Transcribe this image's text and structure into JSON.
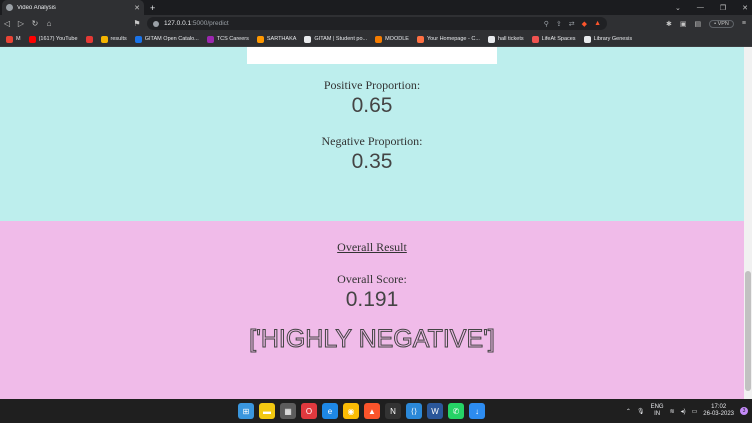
{
  "browser": {
    "tab_title": "Video Analysis",
    "tab_close": "✕",
    "new_tab": "+",
    "url_host": "127.0.0.1",
    "url_path": ":5000/predict",
    "vpn_label": "• VPN",
    "window_controls": [
      "⌄",
      "—",
      "❐",
      "✕"
    ],
    "nav_icons": [
      "◁",
      "▷",
      "↻",
      "⌂"
    ],
    "bookmark_icon": "⚑"
  },
  "bookmarks": [
    {
      "label": "M",
      "color": "#ea4335"
    },
    {
      "label": "(1617) YouTube",
      "color": "#ff0000"
    },
    {
      "label": "",
      "color": "#e53935"
    },
    {
      "label": "results",
      "color": "#f4b400"
    },
    {
      "label": "GITAM Open Catalo...",
      "color": "#1a73e8"
    },
    {
      "label": "TCS Careers",
      "color": "#9c27b0"
    },
    {
      "label": "SARTHAKA",
      "color": "#ff9800"
    },
    {
      "label": "GITAM | Student po...",
      "color": "#e8eaed"
    },
    {
      "label": "MOODLE",
      "color": "#f57c00"
    },
    {
      "label": "Your Homepage - C...",
      "color": "#ff7043"
    },
    {
      "label": "hall tickets",
      "color": "#e8eaed"
    },
    {
      "label": "LifeAt Spaces",
      "color": "#ef5350"
    },
    {
      "label": "Library Genesis",
      "color": "#e8eaed"
    }
  ],
  "page": {
    "positive_label": "Positive Proportion:",
    "positive_value": "0.65",
    "negative_label": "Negative Proportion:",
    "negative_value": "0.35",
    "overall_heading": "Overall Result",
    "score_label": "Overall Score:",
    "score_value": "0.191",
    "verdict": "['HIGHLY NEGATIVE']"
  },
  "colors": {
    "top_section": "#bdeeed",
    "bottom_section": "#f0bbe9"
  },
  "taskbar": {
    "icons": [
      "windows-icon",
      "file-explorer-icon",
      "store-icon",
      "opera-icon",
      "edge-icon",
      "chrome-icon",
      "brave-icon",
      "notion-icon",
      "vscode-icon",
      "word-icon",
      "whatsapp-icon",
      "download-icon"
    ],
    "lang_line1": "ENG",
    "lang_line2": "IN",
    "time": "17:02",
    "date": "26-03-2023",
    "notification_count": "3"
  }
}
